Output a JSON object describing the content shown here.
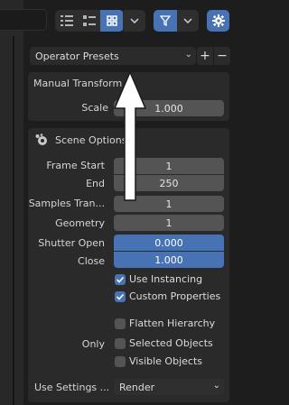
{
  "header": {
    "view_icons": [
      "list-view-icon",
      "thumbnail-small-icon",
      "thumbnail-grid-icon"
    ],
    "active_view": 2,
    "filter_icon": "filter-icon",
    "gear_icon": "gear-icon"
  },
  "presets": {
    "label": "Operator Presets",
    "add": "+",
    "remove": "−"
  },
  "manual_transform": {
    "title": "Manual Transform",
    "scale_label": "Scale",
    "scale_value": "1.000"
  },
  "scene_options": {
    "title": "Scene Options",
    "frame_start_label": "Frame Start",
    "frame_start_value": "1",
    "end_label": "End",
    "end_value": "250",
    "samples_label": "Samples Tran...",
    "samples_value": "1",
    "geometry_label": "Geometry",
    "geometry_value": "1",
    "shutter_open_label": "Shutter Open",
    "shutter_open_value": "0.000",
    "close_label": "Close",
    "close_value": "1.000",
    "use_instancing": "Use Instancing",
    "custom_properties": "Custom Properties",
    "flatten_hierarchy": "Flatten Hierarchy",
    "only_label": "Only",
    "selected_objects": "Selected Objects",
    "visible_objects": "Visible Objects",
    "use_settings_label": "Use Settings ...",
    "use_settings_value": "Render"
  },
  "colors": {
    "accent": "#4772b3",
    "panel": "#2a2a2a",
    "field": "#545454"
  }
}
